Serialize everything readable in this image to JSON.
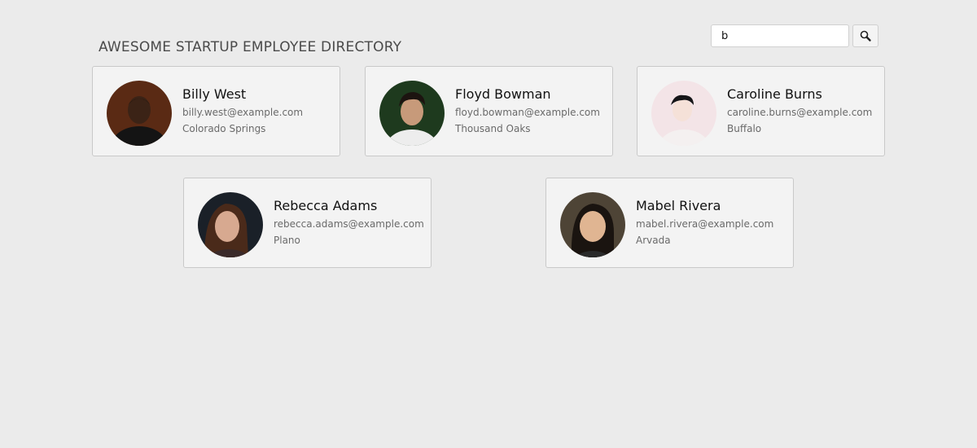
{
  "header": {
    "title": "AWESOME STARTUP EMPLOYEE DIRECTORY"
  },
  "search": {
    "value": "b",
    "placeholder": ""
  },
  "employees": [
    {
      "name": "Billy West",
      "email": "billy.west@example.com",
      "city": "Colorado Springs",
      "avatar_bg": "#5a2a14",
      "avatar_skin": "#3b2316",
      "avatar_clothes": "#141414",
      "avatar_hair": "#1a100a"
    },
    {
      "name": "Floyd Bowman",
      "email": "floyd.bowman@example.com",
      "city": "Thousand Oaks",
      "avatar_bg": "#1e3a1e",
      "avatar_skin": "#c79a7a",
      "avatar_clothes": "#ededed",
      "avatar_hair": "#1c1410"
    },
    {
      "name": "Caroline Burns",
      "email": "caroline.burns@example.com",
      "city": "Buffalo",
      "avatar_bg": "#f3e4e7",
      "avatar_skin": "#f5e1d8",
      "avatar_clothes": "#f4f0f0",
      "avatar_hair": "#151518"
    },
    {
      "name": "Rebecca Adams",
      "email": "rebecca.adams@example.com",
      "city": "Plano",
      "avatar_bg": "#1a2028",
      "avatar_skin": "#d7a990",
      "avatar_clothes": "#3a2a2a",
      "avatar_hair": "#4a2a1a"
    },
    {
      "name": "Mabel Rivera",
      "email": "mabel.rivera@example.com",
      "city": "Arvada",
      "avatar_bg": "#4e4436",
      "avatar_skin": "#e0b592",
      "avatar_clothes": "#2a2a2a",
      "avatar_hair": "#1a1410"
    }
  ]
}
